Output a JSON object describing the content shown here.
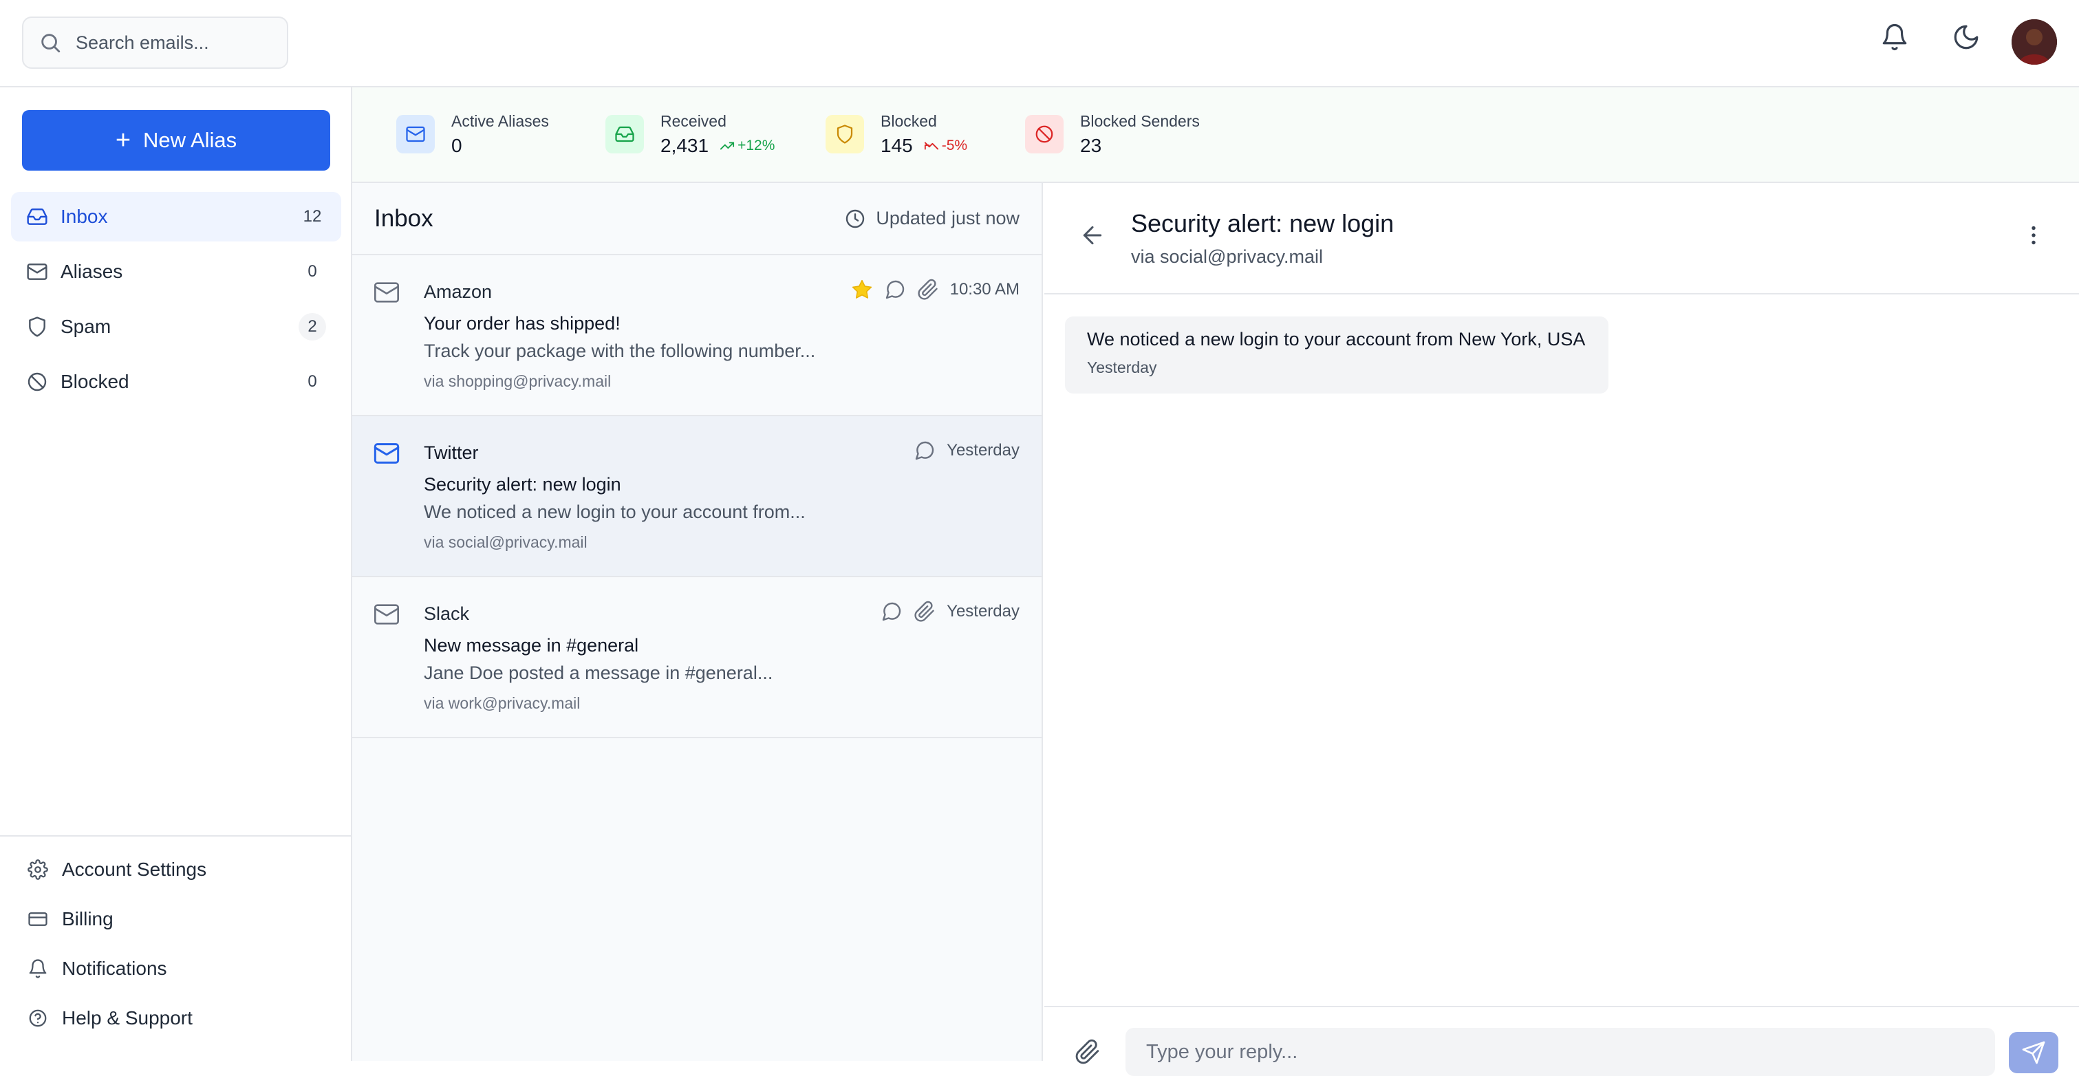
{
  "search": {
    "placeholder": "Search emails..."
  },
  "sidebar": {
    "new_alias_label": "New Alias",
    "items": [
      {
        "label": "Inbox",
        "count": "12"
      },
      {
        "label": "Aliases",
        "count": "0"
      },
      {
        "label": "Spam",
        "count": "2"
      },
      {
        "label": "Blocked",
        "count": "0"
      }
    ],
    "bottom": [
      {
        "label": "Account Settings"
      },
      {
        "label": "Billing"
      },
      {
        "label": "Notifications"
      },
      {
        "label": "Help & Support"
      }
    ]
  },
  "stats": [
    {
      "label": "Active Aliases",
      "value": "0",
      "color": "#2563eb"
    },
    {
      "label": "Received",
      "value": "2,431",
      "delta": "+12%",
      "color": "#16a34a"
    },
    {
      "label": "Blocked",
      "value": "145",
      "delta": "-5%",
      "color": "#ca8a04"
    },
    {
      "label": "Blocked Senders",
      "value": "23",
      "color": "#dc2626"
    }
  ],
  "list": {
    "title": "Inbox",
    "updated": "Updated just now",
    "emails": [
      {
        "sender": "Amazon",
        "time": "10:30 AM",
        "subject": "Your order has shipped!",
        "preview": "Track your package with the following number...",
        "via": "via shopping@privacy.mail"
      },
      {
        "sender": "Twitter",
        "time": "Yesterday",
        "subject": "Security alert: new login",
        "preview": "We noticed a new login to your account from...",
        "via": "via social@privacy.mail"
      },
      {
        "sender": "Slack",
        "time": "Yesterday",
        "subject": "New message in #general",
        "preview": "Jane Doe posted a message in #general...",
        "via": "via work@privacy.mail"
      }
    ]
  },
  "detail": {
    "title": "Security alert: new login",
    "via": "via social@privacy.mail",
    "message": "We noticed a new login to your account from New York, USA",
    "message_time": "Yesterday",
    "reply_placeholder": "Type your reply..."
  },
  "colors": {
    "accent": "#2563eb",
    "star": "#facc15"
  }
}
